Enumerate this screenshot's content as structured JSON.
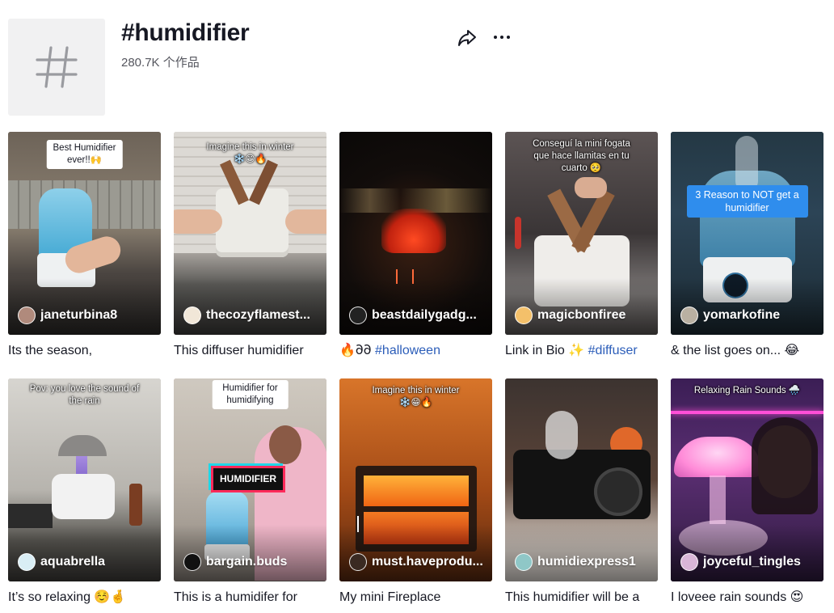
{
  "header": {
    "title": "#humidifier",
    "count": "280.7K 个作品",
    "hero_icon": "hashtag-icon",
    "share_icon": "share-icon",
    "more_icon": "more-icon"
  },
  "videos": [
    {
      "author": "janeturbina8",
      "overlay": "Best Humidifier ever!!🙌",
      "caption": "Its the season,",
      "hashtags": "",
      "thumb_color": "#8a7f70",
      "avatar_color": "#b08a7c"
    },
    {
      "author": "thecozyflamest...",
      "overlay": "Imagine this in winter\n❄️😁🔥",
      "caption": "This diffuser humidifier",
      "hashtags": "",
      "thumb_color": "#9c8f85",
      "avatar_color": "#f1e7d8"
    },
    {
      "author": "beastdailygadg...",
      "overlay": "",
      "caption": "🔥𐐀𐐀 ",
      "hashtags": "#halloween",
      "thumb_color": "#14110f",
      "avatar_color": "#222222"
    },
    {
      "author": "magicbonfiree",
      "overlay": "Conseguí la mini fogata\nque hace llamitas en tu\ncuarto 🥺",
      "caption": "Link in Bio ✨ ",
      "hashtags": "#diffuser",
      "thumb_color": "#6b5f58",
      "avatar_color": "#f4c06a"
    },
    {
      "author": "yomarkofine",
      "overlay": "3 Reason to NOT get a\nhumidifier",
      "caption": "& the list goes on... 😂",
      "hashtags": "",
      "thumb_color": "#2b3d4a",
      "avatar_color": "#b9b0a2"
    },
    {
      "author": "aquabrella",
      "overlay": "Pov: you love the sound of\nthe rain",
      "caption": "It’s so relaxing ☺️🤞",
      "hashtags": "",
      "thumb_color": "#a9a59f",
      "avatar_color": "#d9eef5"
    },
    {
      "author": "bargain.buds",
      "overlay": "Humidifier for humidifying",
      "overlay2": "HUMIDIFIER",
      "caption": "This is a humidifer for",
      "hashtags": "",
      "thumb_color": "#b58f8d",
      "avatar_color": "#111111"
    },
    {
      "author": "must.haveprodu...",
      "overlay": "Imagine this in winter\n❄️😁🔥",
      "caption": "My mini Fireplace",
      "hashtags": "",
      "thumb_color": "#b35a16",
      "avatar_color": "#3a2a22"
    },
    {
      "author": "humidiexpress1",
      "overlay": "",
      "caption": "This humidifier will be a",
      "hashtags": "",
      "thumb_color": "#3b2f2a",
      "avatar_color": "#8fc7c7"
    },
    {
      "author": "joyceful_tingles",
      "overlay": "Relaxing Rain Sounds 🌧️",
      "caption": "I loveee rain sounds 😍",
      "hashtags": "",
      "thumb_color": "#4a2a5e",
      "avatar_color": "#d9b6d8"
    }
  ]
}
